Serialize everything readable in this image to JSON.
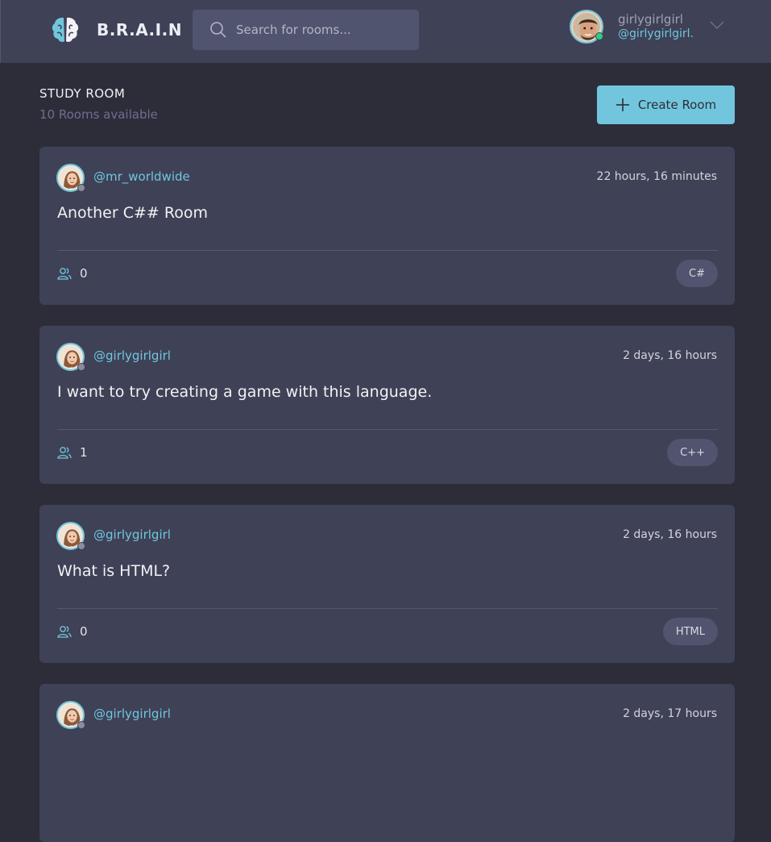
{
  "header": {
    "logo_text": "B.R.A.I.N",
    "search_placeholder": "Search for rooms...",
    "user": {
      "name": "girlygirlgirl",
      "handle": "@girlygirlgirl."
    }
  },
  "section": {
    "title": "STUDY ROOM",
    "subtitle": "10 Rooms available",
    "create_label": "Create Room"
  },
  "rooms": [
    {
      "host": "@mr_worldwide",
      "time": "22 hours, 16 minutes",
      "title": "Another C## Room",
      "participants": "0",
      "topic": "C#"
    },
    {
      "host": "@girlygirlgirl",
      "time": "2 days, 16 hours",
      "title": "I want to try creating a game with this language.",
      "participants": "1",
      "topic": "C++"
    },
    {
      "host": "@girlygirlgirl",
      "time": "2 days, 16 hours",
      "title": "What is HTML?",
      "participants": "0",
      "topic": "HTML"
    },
    {
      "host": "@girlygirlgirl",
      "time": "2 days, 17 hours",
      "title": "",
      "participants": "",
      "topic": ""
    }
  ],
  "colors": {
    "accent": "#71c6dd",
    "background": "#2d2d3a",
    "card": "#3f4156"
  }
}
